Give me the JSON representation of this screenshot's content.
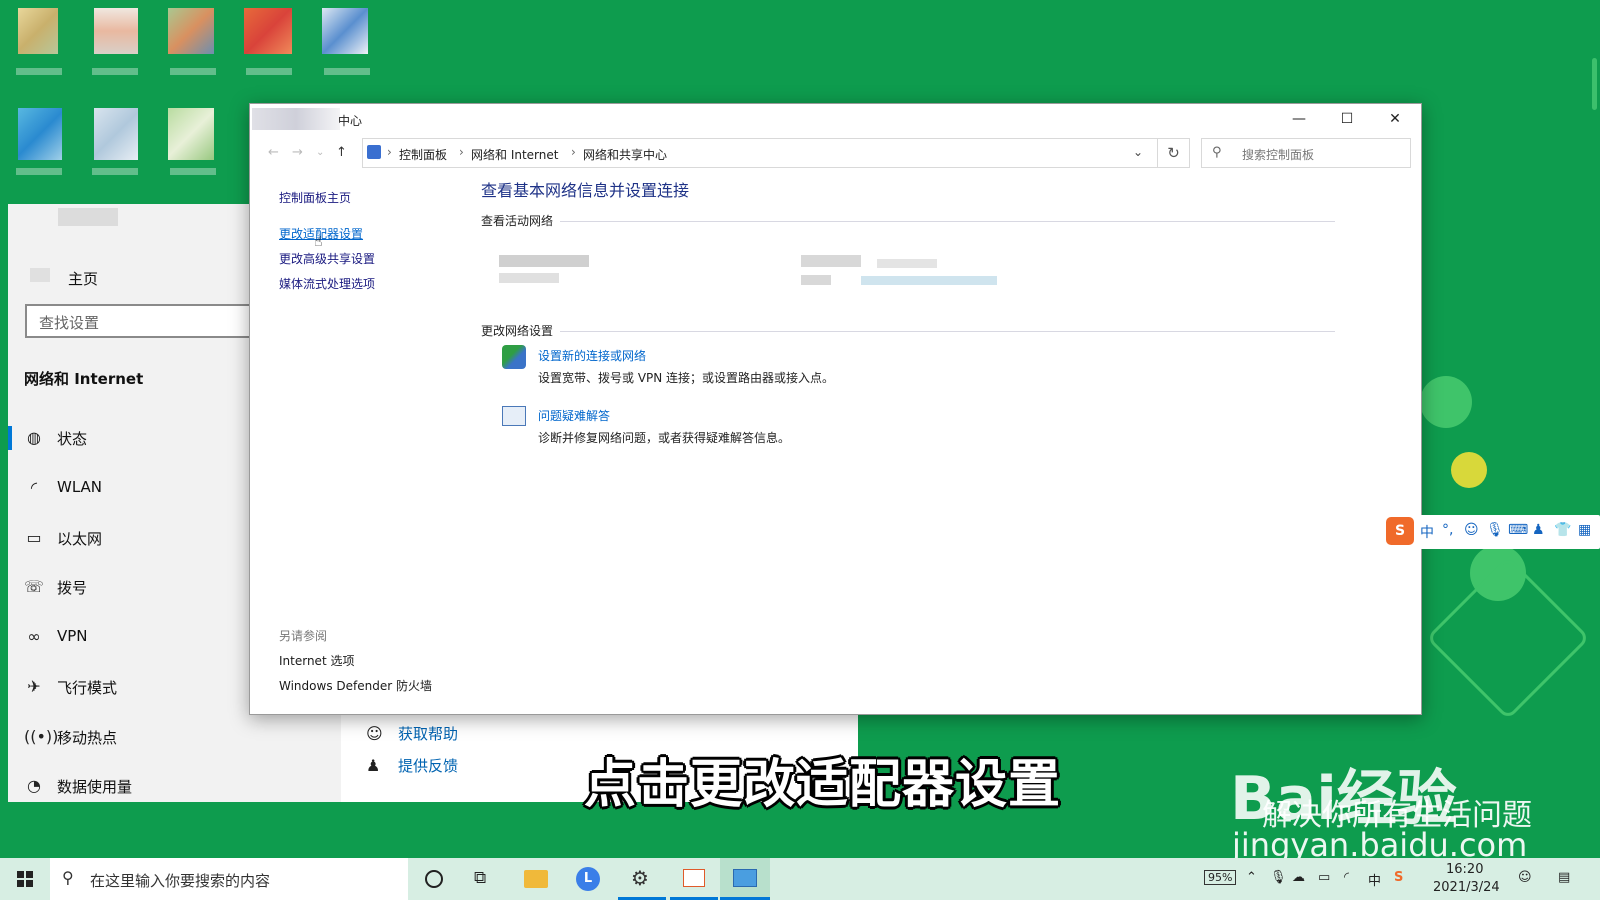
{
  "settings": {
    "home_label": "主页",
    "search_placeholder": "查找设置",
    "section_title": "网络和 Internet",
    "nav": [
      {
        "label": "状态",
        "icon": "globe-icon"
      },
      {
        "label": "WLAN",
        "icon": "wifi-icon"
      },
      {
        "label": "以太网",
        "icon": "ethernet-icon"
      },
      {
        "label": "拨号",
        "icon": "dialup-icon"
      },
      {
        "label": "VPN",
        "icon": "vpn-icon"
      },
      {
        "label": "飞行模式",
        "icon": "airplane-icon"
      },
      {
        "label": "移动热点",
        "icon": "hotspot-icon"
      },
      {
        "label": "数据使用量",
        "icon": "data-usage-icon"
      }
    ],
    "help": {
      "get_help": "获取帮助",
      "feedback": "提供反馈"
    }
  },
  "control_panel": {
    "title_suffix": "中心",
    "breadcrumb": [
      "控制面板",
      "网络和 Internet",
      "网络和共享中心"
    ],
    "search_placeholder": "搜索控制面板",
    "left_links": [
      "控制面板主页",
      "更改适配器设置",
      "更改高级共享设置",
      "媒体流式处理选项"
    ],
    "see_also_title": "另请参阅",
    "see_also": [
      "Internet 选项",
      "Windows Defender 防火墙"
    ],
    "heading": "查看基本网络信息并设置连接",
    "active_networks_label": "查看活动网络",
    "change_settings_label": "更改网络设置",
    "tasks": [
      {
        "title": "设置新的连接或网络",
        "desc": "设置宽带、拨号或 VPN 连接；或设置路由器或接入点。",
        "icon": "new-connection-icon"
      },
      {
        "title": "问题疑难解答",
        "desc": "诊断并修复网络问题，或者获得疑难解答信息。",
        "icon": "troubleshoot-icon"
      }
    ]
  },
  "ime": {
    "mode": "中",
    "punct": "°,"
  },
  "subtitle": "点击更改适配器设置",
  "watermark": {
    "brand": "Bai经验",
    "slogan": "解决你所有生活问题",
    "url": "jingyan.baidu.com"
  },
  "taskbar": {
    "search_placeholder": "在这里输入你要搜索的内容",
    "battery": "95%",
    "time": "16:20",
    "date": "2021/3/24"
  },
  "colors": {
    "desktop": "#0e9c4e",
    "accent": "#0078d7",
    "link": "#0066cc",
    "heading": "#1e3287"
  }
}
